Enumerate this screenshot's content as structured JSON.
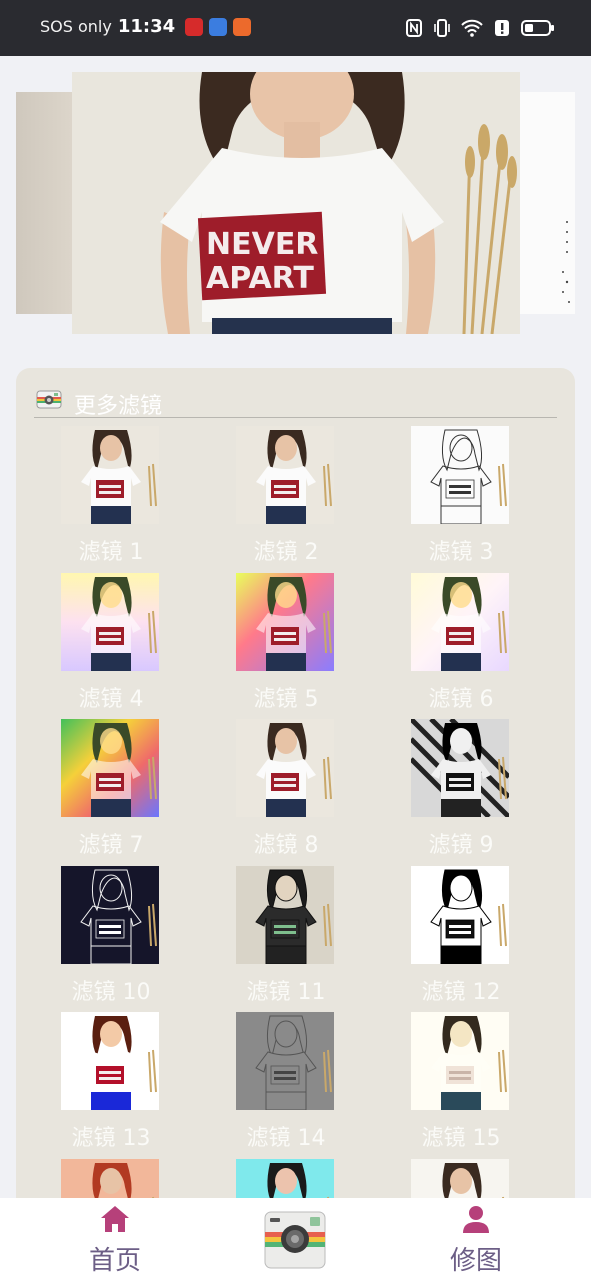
{
  "status": {
    "sos_text": "SOS only",
    "time": "11:34"
  },
  "banner": {
    "shirt_text_line1": "NEVER",
    "shirt_text_line2": "APART"
  },
  "filters_panel": {
    "title": "更多滤镜",
    "items": [
      {
        "label": "滤镜 1",
        "style": "original"
      },
      {
        "label": "滤镜 2",
        "style": "original"
      },
      {
        "label": "滤镜 3",
        "style": "sketch"
      },
      {
        "label": "滤镜 4",
        "style": "rainbow-light"
      },
      {
        "label": "滤镜 5",
        "style": "rainbow"
      },
      {
        "label": "滤镜 6",
        "style": "rainbow-pale"
      },
      {
        "label": "滤镜 7",
        "style": "rainbow-diagonal"
      },
      {
        "label": "滤镜 8",
        "style": "original"
      },
      {
        "label": "滤镜 9",
        "style": "halftone"
      },
      {
        "label": "滤镜 10",
        "style": "neon-edge"
      },
      {
        "label": "滤镜 11",
        "style": "color-edge"
      },
      {
        "label": "滤镜 12",
        "style": "bw-threshold"
      },
      {
        "label": "滤镜 13",
        "style": "high-contrast"
      },
      {
        "label": "滤镜 14",
        "style": "emboss"
      },
      {
        "label": "滤镜 15",
        "style": "dots"
      },
      {
        "label": "",
        "style": "warm"
      },
      {
        "label": "",
        "style": "cyan"
      },
      {
        "label": "",
        "style": "fade"
      }
    ]
  },
  "nav": {
    "home_label": "首页",
    "edit_label": "修图"
  },
  "colors": {
    "accent": "#b6407a",
    "nav_text": "#6c5e86",
    "panel_bg": "#e8e5dd"
  }
}
